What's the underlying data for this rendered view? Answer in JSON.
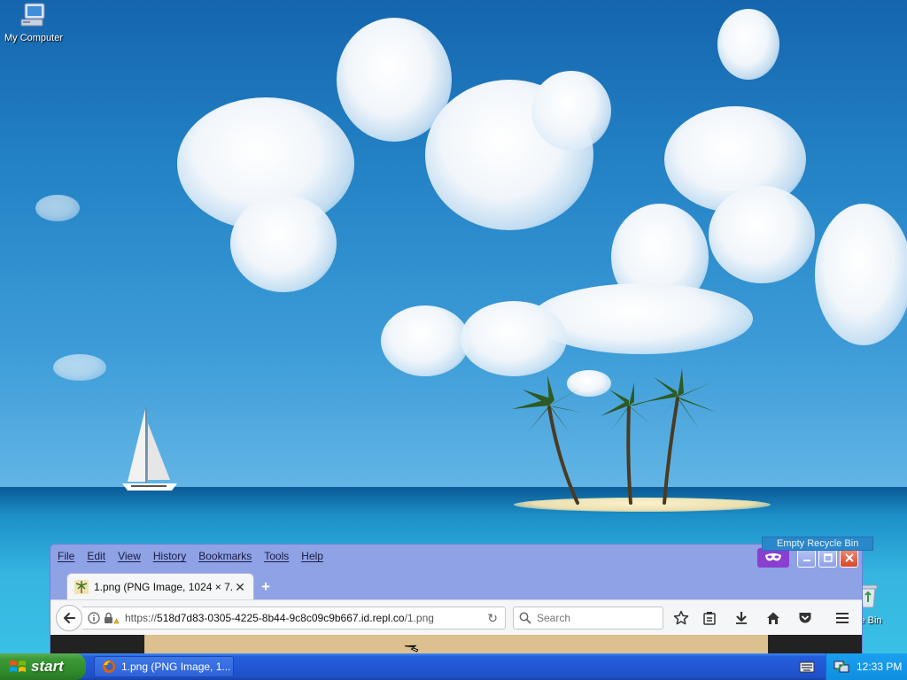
{
  "desktop": {
    "icons": [
      {
        "label": "My Computer"
      },
      {
        "label": "le Bin"
      }
    ],
    "tooltip": "Empty Recycle Bin"
  },
  "firefox": {
    "menu": [
      "File",
      "Edit",
      "View",
      "History",
      "Bookmarks",
      "Tools",
      "Help"
    ],
    "tab": {
      "title": "1.png (PNG Image, 1024 × 7..."
    },
    "url": {
      "prefix": "https://",
      "host": "518d7d83-0305-4225-8b44-9c8c09c9b667.id.repl.co",
      "path": "/1.png"
    },
    "search_placeholder": "Search"
  },
  "taskbar": {
    "start_label": "start",
    "task_label": "1.png (PNG Image, 1...",
    "clock": "12:33 PM"
  },
  "colors": {
    "taskbar": "#245edb",
    "start": "#3c9a37",
    "firefox_frame": "#8fa2e6",
    "private_mask": "#8a3fd1"
  }
}
